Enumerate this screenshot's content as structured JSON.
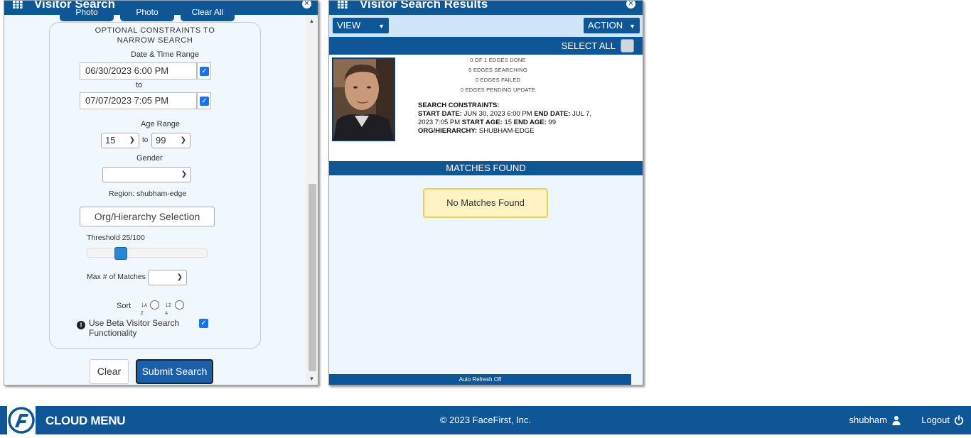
{
  "left_panel": {
    "title": "Visitor Search",
    "top_buttons": [
      "Photo",
      "Photo",
      "Clear All"
    ],
    "constraints_heading_line1": "OPTIONAL CONSTRAINTS TO",
    "constraints_heading_line2": "NARROW SEARCH",
    "date_range_label": "Date & Time Range",
    "start_datetime": "06/30/2023 6:00 PM",
    "to_label": "to",
    "end_datetime": "07/07/2023 7:05 PM",
    "age_range_label": "Age Range",
    "age_min": "15",
    "age_to_label": "to",
    "age_max": "99",
    "gender_label": "Gender",
    "gender_value": "",
    "region_text": "Region: shubham-edge",
    "org_button": "Org/Hierarchy Selection",
    "threshold_label": "Threshold 25/100",
    "threshold_value": 25,
    "threshold_max": 100,
    "max_matches_label": "Max # of Matches",
    "max_matches_value": "",
    "sort_label": "Sort",
    "beta_label": "Use Beta Visitor Search Functionality",
    "beta_checked": true,
    "clear_button": "Clear",
    "submit_button": "Submit Search"
  },
  "right_panel": {
    "title": "Visitor Search Results",
    "view_button": "VIEW",
    "action_button": "ACTION",
    "select_all": "SELECT ALL",
    "edge_stats": [
      "0 OF 1 EDGES DONE",
      "0 EDGES SEARCHING",
      "0 EDGES FAILED",
      "0 EDGES PENDING UPDATE"
    ],
    "search_constraints_label": "SEARCH CONSTRAINTS:",
    "start_date_label": "START DATE:",
    "start_date_value": "JUN 30, 2023 6:00 PM",
    "end_date_label": "END DATE:",
    "end_date_value": "JUL 7, 2023 7:05 PM",
    "start_age_label": "START AGE:",
    "start_age_value": "15",
    "end_age_label": "END AGE:",
    "end_age_value": "99",
    "org_label": "ORG/HIERARCHY:",
    "org_value": "SHUBHAM-EDGE",
    "matches_found": "MATCHES FOUND",
    "no_matches": "No Matches Found",
    "auto_refresh": "Auto Refresh Off"
  },
  "footer": {
    "menu": "CLOUD MENU",
    "copyright": "© 2023 FaceFirst, Inc.",
    "user": "shubham",
    "logout": "Logout"
  },
  "colors": {
    "brand_blue": "#0f5696",
    "panel_bg": "#f0f7fd",
    "toolbar_bg": "#cfe5f9",
    "no_match_bg": "#fff3c4",
    "no_match_border": "#f2cd55"
  },
  "icons": [
    "grid-icon",
    "close-icon",
    "chevron-down-icon",
    "sort-ascending-icon",
    "sort-descending-icon",
    "info-icon",
    "user-icon",
    "power-icon",
    "facefirst-logo"
  ]
}
